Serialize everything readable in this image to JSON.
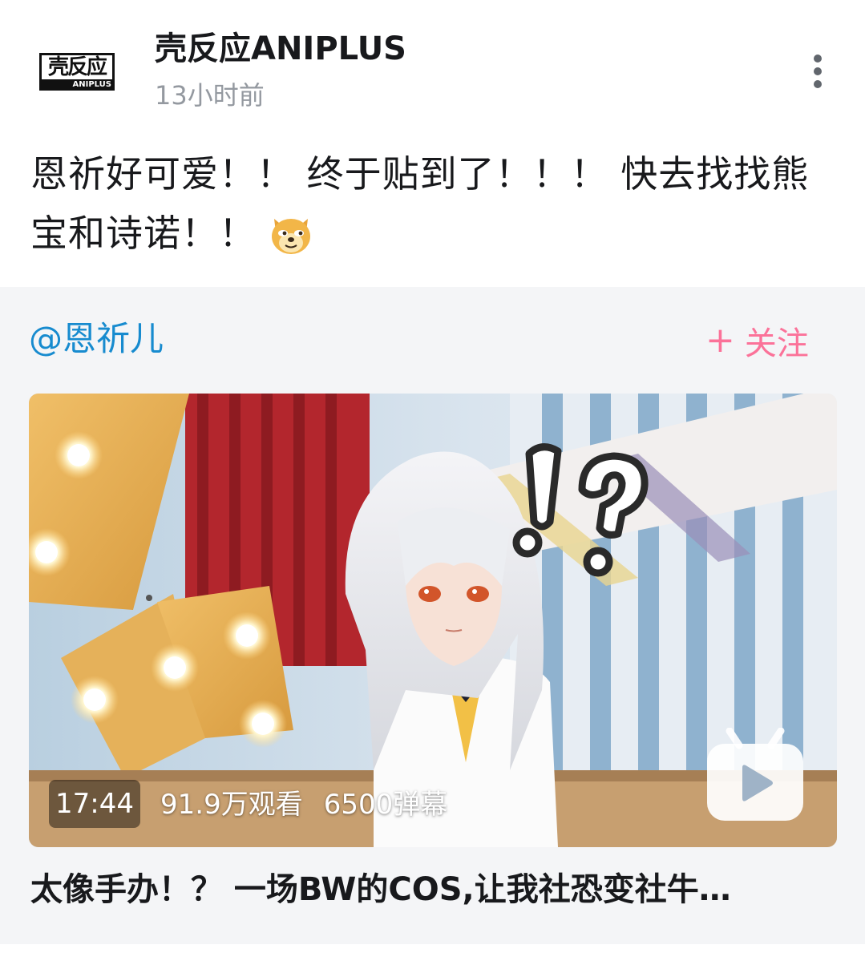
{
  "author": {
    "name": "壳反应ANIPLUS",
    "time": "13小时前",
    "logo_top": "壳反应",
    "logo_bottom": "ANIPLUS"
  },
  "post": {
    "text": "恩祈好可爱！！ 终于贴到了！！！ 快去找找熊宝和诗诺！！",
    "emoji": "doge-emoji"
  },
  "forward": {
    "mention": "@恩祈儿",
    "follow_label": "关注",
    "follow_icon": "plus-icon"
  },
  "video": {
    "duration": "17:44",
    "views": "91.9万观看",
    "danmaku": "6500弹幕",
    "title": "太像手办！？ 一场BW的COS,让我社恐变社牛…",
    "overlay_text": "!?",
    "badge_icon": "bilibili-tv-icon"
  },
  "colors": {
    "mention": "#178bcf",
    "follow": "#fb7299",
    "time": "#9499a0",
    "forward_bg": "#f4f5f7"
  }
}
